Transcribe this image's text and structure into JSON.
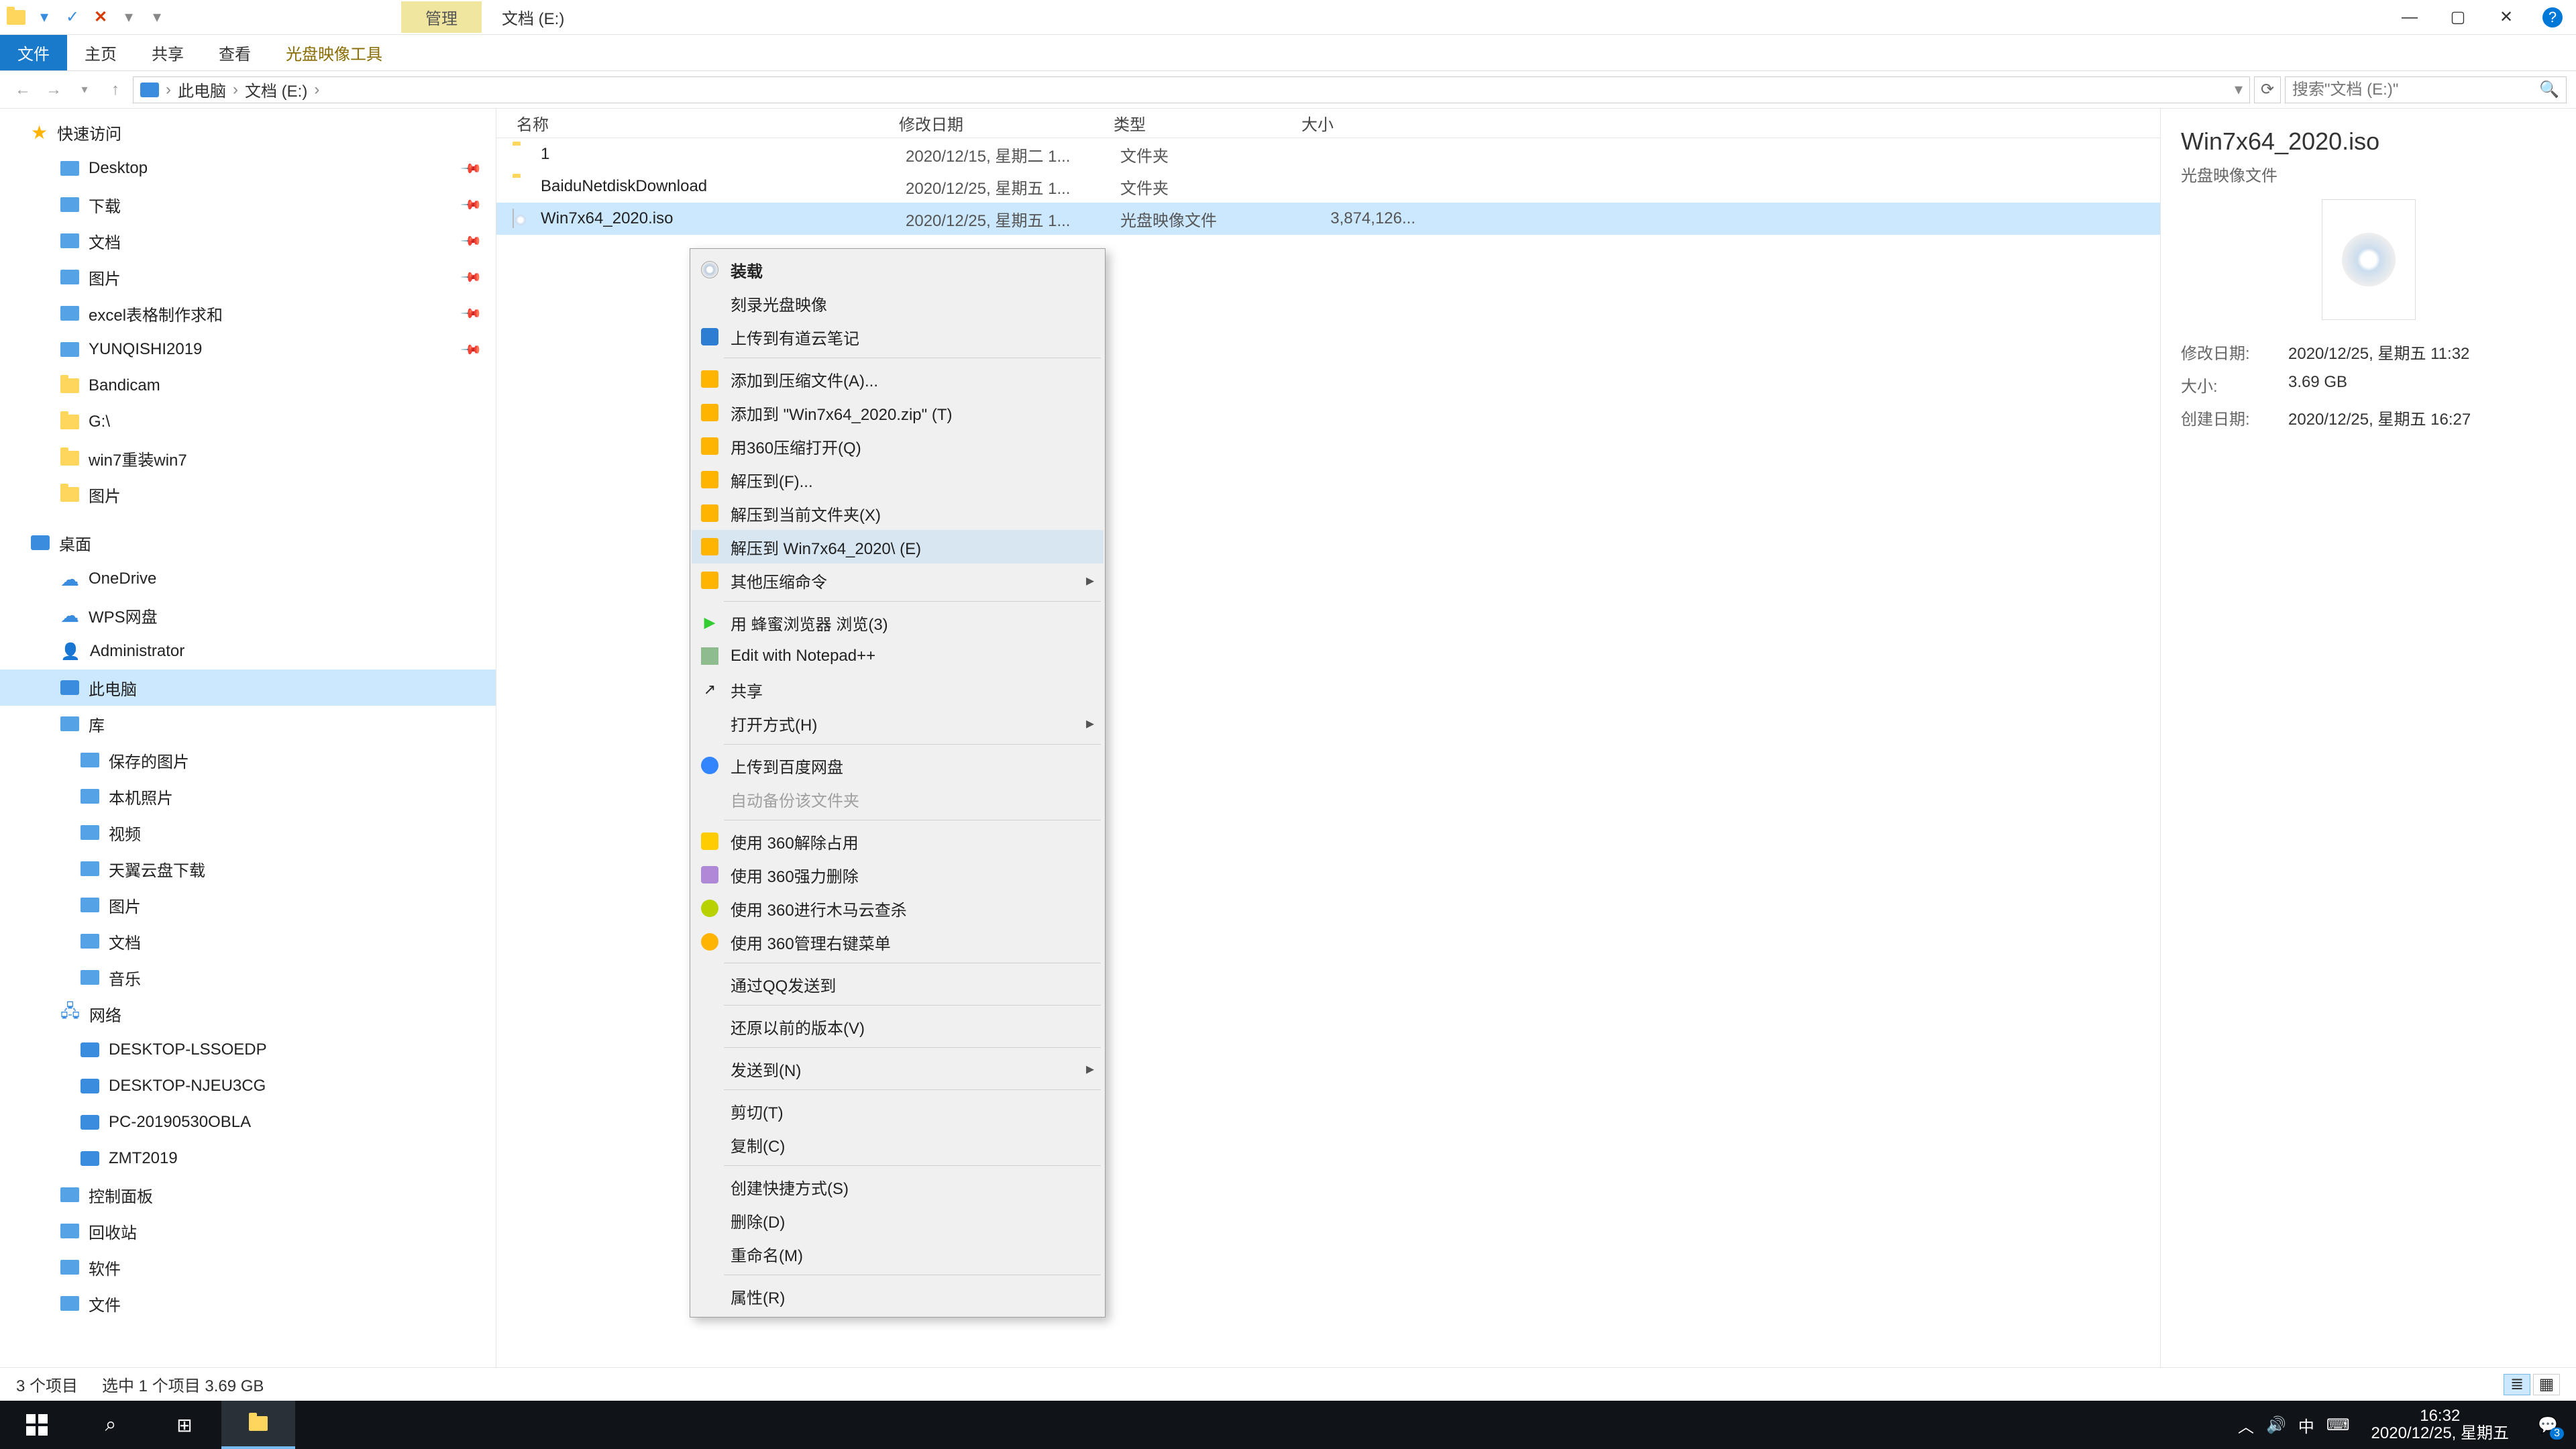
{
  "titlebar": {
    "active_tab": "管理",
    "title": "文档 (E:)"
  },
  "ribbon": {
    "file": "文件",
    "home": "主页",
    "share": "共享",
    "view": "查看",
    "tool": "光盘映像工具"
  },
  "breadcrumb": {
    "root": "此电脑",
    "folder": "文档 (E:)"
  },
  "search": {
    "placeholder": "搜索\"文档 (E:)\""
  },
  "sidebar": {
    "quick": "快速访问",
    "items_pinned": [
      {
        "label": "Desktop"
      },
      {
        "label": "下载"
      },
      {
        "label": "文档"
      },
      {
        "label": "图片"
      },
      {
        "label": "excel表格制作求和"
      },
      {
        "label": "YUNQISHI2019"
      }
    ],
    "items_recent": [
      {
        "label": "Bandicam"
      },
      {
        "label": "G:\\"
      },
      {
        "label": "win7重装win7"
      },
      {
        "label": "图片"
      }
    ],
    "desktop": "桌面",
    "desktop_items": [
      {
        "label": "OneDrive",
        "icon": "cloud"
      },
      {
        "label": "WPS网盘",
        "icon": "cloud"
      },
      {
        "label": "Administrator",
        "icon": "user"
      },
      {
        "label": "此电脑",
        "icon": "pc",
        "selected": true
      },
      {
        "label": "库",
        "icon": "lib"
      }
    ],
    "lib_items": [
      {
        "label": "保存的图片"
      },
      {
        "label": "本机照片"
      },
      {
        "label": "视频"
      },
      {
        "label": "天翼云盘下载"
      },
      {
        "label": "图片"
      },
      {
        "label": "文档"
      },
      {
        "label": "音乐"
      }
    ],
    "network": "网络",
    "net_items": [
      {
        "label": "DESKTOP-LSSOEDP"
      },
      {
        "label": "DESKTOP-NJEU3CG"
      },
      {
        "label": "PC-20190530OBLA"
      },
      {
        "label": "ZMT2019"
      }
    ],
    "others": [
      {
        "label": "控制面板"
      },
      {
        "label": "回收站"
      },
      {
        "label": "软件"
      },
      {
        "label": "文件"
      }
    ]
  },
  "list": {
    "hdr_name": "名称",
    "hdr_date": "修改日期",
    "hdr_type": "类型",
    "hdr_size": "大小",
    "rows": [
      {
        "name": "1",
        "date": "2020/12/15, 星期二 1...",
        "type": "文件夹",
        "size": "",
        "icon": "folder"
      },
      {
        "name": "BaiduNetdiskDownload",
        "date": "2020/12/25, 星期五 1...",
        "type": "文件夹",
        "size": "",
        "icon": "folder"
      },
      {
        "name": "Win7x64_2020.iso",
        "date": "2020/12/25, 星期五 1...",
        "type": "光盘映像文件",
        "size": "3,874,126...",
        "icon": "iso",
        "selected": true
      }
    ]
  },
  "ctx": [
    {
      "label": "装载",
      "icon": "disc",
      "bold": true
    },
    {
      "label": "刻录光盘映像"
    },
    {
      "label": "上传到有道云笔记",
      "icon": "blue"
    },
    {
      "sep": true
    },
    {
      "label": "添加到压缩文件(A)...",
      "icon": "zip"
    },
    {
      "label": "添加到 \"Win7x64_2020.zip\" (T)",
      "icon": "zip"
    },
    {
      "label": "用360压缩打开(Q)",
      "icon": "zip"
    },
    {
      "label": "解压到(F)...",
      "icon": "zip"
    },
    {
      "label": "解压到当前文件夹(X)",
      "icon": "zip"
    },
    {
      "label": "解压到 Win7x64_2020\\ (E)",
      "icon": "zip",
      "highlight": true
    },
    {
      "label": "其他压缩命令",
      "icon": "zip",
      "arrow": true
    },
    {
      "sep": true
    },
    {
      "label": "用 蜂蜜浏览器 浏览(3)",
      "icon": "green"
    },
    {
      "label": "Edit with Notepad++",
      "icon": "npp"
    },
    {
      "label": "共享",
      "icon": "share"
    },
    {
      "label": "打开方式(H)",
      "arrow": true
    },
    {
      "sep": true
    },
    {
      "label": "上传到百度网盘",
      "icon": "baidu"
    },
    {
      "label": "自动备份该文件夹",
      "disabled": true
    },
    {
      "sep": true
    },
    {
      "label": "使用 360解除占用",
      "icon": "360"
    },
    {
      "label": "使用 360强力删除",
      "icon": "360b"
    },
    {
      "label": "使用 360进行木马云查杀",
      "icon": "360c"
    },
    {
      "label": "使用 360管理右键菜单",
      "icon": "360d"
    },
    {
      "sep": true
    },
    {
      "label": "通过QQ发送到"
    },
    {
      "sep": true
    },
    {
      "label": "还原以前的版本(V)"
    },
    {
      "sep": true
    },
    {
      "label": "发送到(N)",
      "arrow": true
    },
    {
      "sep": true
    },
    {
      "label": "剪切(T)"
    },
    {
      "label": "复制(C)"
    },
    {
      "sep": true
    },
    {
      "label": "创建快捷方式(S)"
    },
    {
      "label": "删除(D)"
    },
    {
      "label": "重命名(M)"
    },
    {
      "sep": true
    },
    {
      "label": "属性(R)"
    }
  ],
  "preview": {
    "title": "Win7x64_2020.iso",
    "sub": "光盘映像文件",
    "rows": [
      {
        "label": "修改日期:",
        "value": "2020/12/25, 星期五 11:32"
      },
      {
        "label": "大小:",
        "value": "3.69 GB"
      },
      {
        "label": "创建日期:",
        "value": "2020/12/25, 星期五 16:27"
      }
    ]
  },
  "status": {
    "count": "3 个项目",
    "sel": "选中 1 个项目  3.69 GB"
  },
  "taskbar": {
    "time": "16:32",
    "date": "2020/12/25, 星期五",
    "ime": "中",
    "badge": "3"
  }
}
